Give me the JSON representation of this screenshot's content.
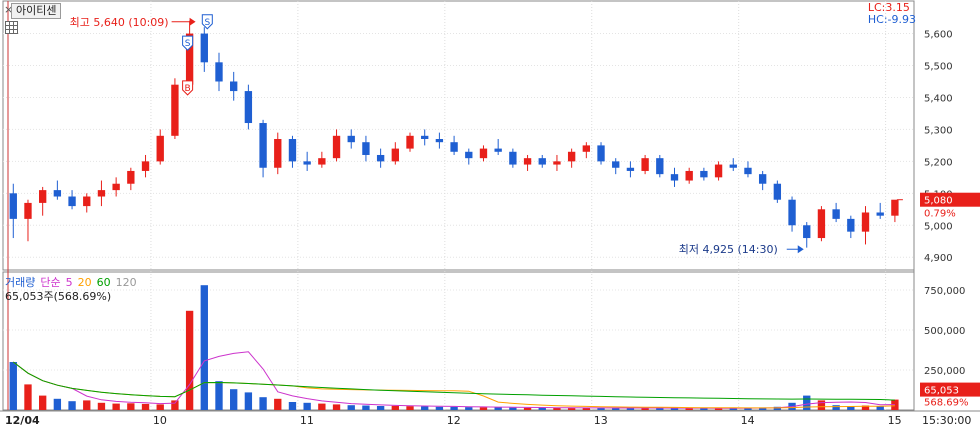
{
  "stock": {
    "name": "아이티센"
  },
  "indicators": {
    "lc": "LC:3.15",
    "hc": "HC:-9.93"
  },
  "annotations": {
    "high": "최고 5,640 (10:09)",
    "low": "최저 4,925 (14:30)",
    "sell_mark": "S",
    "buy_mark": "B"
  },
  "current": {
    "price": "5,080",
    "change": "0.79%"
  },
  "volume_panel": {
    "title": "거래량",
    "ma_type": "단순",
    "ma_periods": [
      "5",
      "20",
      "60",
      "120"
    ],
    "current_volume": "65,053주(568.69%)",
    "last_volume": "65,053",
    "last_ratio": "568.69%"
  },
  "colors": {
    "up": "#e8201a",
    "down": "#1f5fd2",
    "ma5": "#cc33cc",
    "ma20": "#ffa000",
    "ma60": "#00a000",
    "ma120": "#999999"
  },
  "chart_data": [
    {
      "type": "candlestick",
      "title": "아이티센",
      "y_ticks": [
        4900,
        5000,
        5100,
        5200,
        5300,
        5400,
        5500,
        5600
      ],
      "y_tick_labels": [
        "4,900",
        "5,000",
        "5,100",
        "5,200",
        "5,300",
        "5,400",
        "5,500",
        "5,600"
      ],
      "x_labels": [
        "12/04",
        "10",
        "11",
        "12",
        "13",
        "14",
        "15",
        "15:30:00"
      ],
      "ylim": [
        4860,
        5680
      ],
      "candles": [
        [
          5100,
          5130,
          4960,
          5020
        ],
        [
          5020,
          5080,
          4950,
          5070
        ],
        [
          5070,
          5120,
          5030,
          5110
        ],
        [
          5110,
          5140,
          5080,
          5090
        ],
        [
          5090,
          5110,
          5050,
          5060
        ],
        [
          5060,
          5100,
          5040,
          5090
        ],
        [
          5090,
          5140,
          5060,
          5110
        ],
        [
          5110,
          5150,
          5090,
          5130
        ],
        [
          5130,
          5180,
          5110,
          5170
        ],
        [
          5170,
          5220,
          5150,
          5200
        ],
        [
          5200,
          5300,
          5190,
          5280
        ],
        [
          5280,
          5460,
          5270,
          5440
        ],
        [
          5440,
          5640,
          5420,
          5600
        ],
        [
          5600,
          5620,
          5480,
          5510
        ],
        [
          5510,
          5540,
          5420,
          5450
        ],
        [
          5450,
          5480,
          5390,
          5420
        ],
        [
          5420,
          5440,
          5300,
          5320
        ],
        [
          5320,
          5330,
          5150,
          5180
        ],
        [
          5180,
          5290,
          5160,
          5270
        ],
        [
          5270,
          5280,
          5180,
          5200
        ],
        [
          5200,
          5230,
          5170,
          5190
        ],
        [
          5190,
          5230,
          5180,
          5210
        ],
        [
          5210,
          5300,
          5200,
          5280
        ],
        [
          5280,
          5300,
          5240,
          5260
        ],
        [
          5260,
          5280,
          5200,
          5220
        ],
        [
          5220,
          5240,
          5180,
          5200
        ],
        [
          5200,
          5260,
          5190,
          5240
        ],
        [
          5240,
          5290,
          5230,
          5280
        ],
        [
          5280,
          5300,
          5250,
          5270
        ],
        [
          5270,
          5290,
          5240,
          5260
        ],
        [
          5260,
          5280,
          5220,
          5230
        ],
        [
          5230,
          5240,
          5190,
          5210
        ],
        [
          5210,
          5250,
          5200,
          5240
        ],
        [
          5240,
          5270,
          5220,
          5230
        ],
        [
          5230,
          5240,
          5180,
          5190
        ],
        [
          5190,
          5220,
          5170,
          5210
        ],
        [
          5210,
          5220,
          5180,
          5190
        ],
        [
          5190,
          5220,
          5170,
          5200
        ],
        [
          5200,
          5240,
          5180,
          5230
        ],
        [
          5230,
          5260,
          5210,
          5250
        ],
        [
          5250,
          5260,
          5190,
          5200
        ],
        [
          5200,
          5210,
          5160,
          5180
        ],
        [
          5180,
          5200,
          5150,
          5170
        ],
        [
          5170,
          5220,
          5160,
          5210
        ],
        [
          5210,
          5220,
          5150,
          5160
        ],
        [
          5160,
          5180,
          5120,
          5140
        ],
        [
          5140,
          5180,
          5130,
          5170
        ],
        [
          5170,
          5180,
          5140,
          5150
        ],
        [
          5150,
          5200,
          5140,
          5190
        ],
        [
          5190,
          5210,
          5170,
          5180
        ],
        [
          5180,
          5200,
          5150,
          5160
        ],
        [
          5160,
          5170,
          5110,
          5130
        ],
        [
          5130,
          5140,
          5070,
          5080
        ],
        [
          5080,
          5090,
          4980,
          5000
        ],
        [
          5000,
          5010,
          4930,
          4960
        ],
        [
          4960,
          5060,
          4950,
          5050
        ],
        [
          5050,
          5070,
          5010,
          5020
        ],
        [
          5020,
          5030,
          4960,
          4980
        ],
        [
          4980,
          5060,
          4940,
          5040
        ],
        [
          5040,
          5070,
          5020,
          5030
        ],
        [
          5030,
          5060,
          5010,
          5080
        ]
      ],
      "high": {
        "value": 5640,
        "time": "10:09"
      },
      "low": {
        "value": 4925,
        "time": "14:30"
      },
      "last_price": 5080
    },
    {
      "type": "bar",
      "title": "거래량",
      "y_ticks": [
        250000,
        500000,
        750000
      ],
      "y_tick_labels": [
        "250,000",
        "500,000",
        "750,000"
      ],
      "ylim": [
        0,
        800000
      ],
      "values": [
        300000,
        160000,
        90000,
        70000,
        55000,
        60000,
        45000,
        40000,
        42000,
        38000,
        35000,
        60000,
        620000,
        780000,
        180000,
        130000,
        110000,
        80000,
        70000,
        50000,
        45000,
        40000,
        35000,
        30000,
        28000,
        25000,
        26000,
        24000,
        22000,
        20000,
        20000,
        18000,
        17000,
        16000,
        15000,
        14000,
        15000,
        13000,
        12000,
        13000,
        14000,
        12000,
        11000,
        12000,
        13000,
        12000,
        11000,
        10000,
        11000,
        12000,
        14000,
        16000,
        20000,
        45000,
        90000,
        60000,
        30000,
        25000,
        28000,
        22000,
        65053
      ],
      "last_value": 65053
    }
  ]
}
